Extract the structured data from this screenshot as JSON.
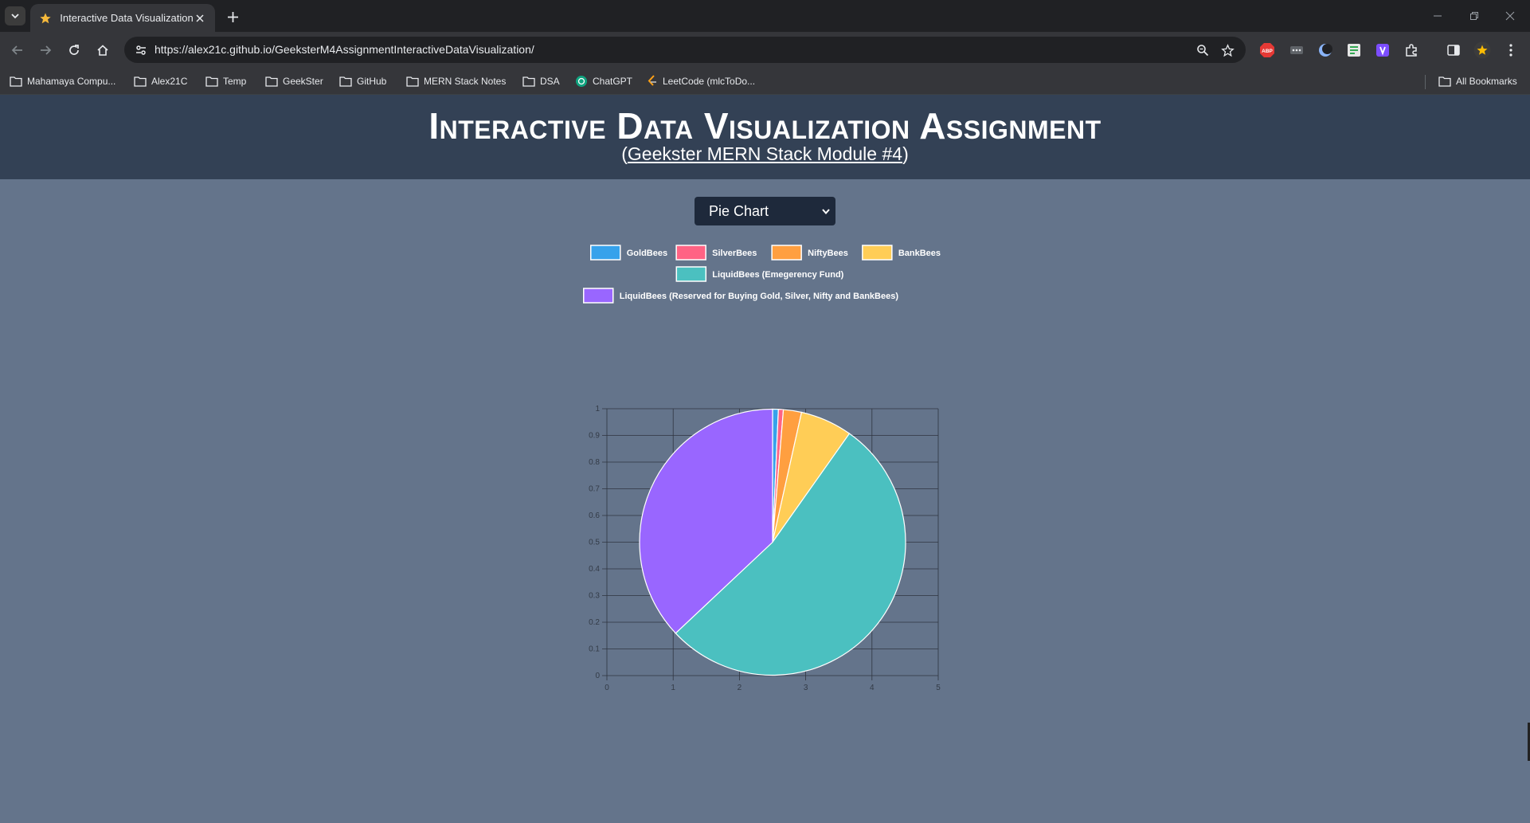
{
  "browser": {
    "tab_title": "Interactive Data Visualization",
    "url": "https://alex21c.github.io/GeeksterM4AssignmentInteractiveDataVisualization/",
    "bookmarks": [
      "Mahamaya Compu...",
      "Alex21C",
      "Temp",
      "GeekSter",
      "GitHub",
      "MERN Stack Notes",
      "DSA",
      "ChatGPT",
      "LeetCode (mlcToDo..."
    ],
    "all_bookmarks": "All Bookmarks"
  },
  "page": {
    "title": "Interactive Data Visualization Assignment",
    "subtitle_open": "(",
    "subtitle_link": "Geekster MERN Stack Module #4",
    "subtitle_close": ")",
    "background": "#64748b",
    "header_background": "#334155"
  },
  "chart_select": {
    "selected": "Pie Chart"
  },
  "chart_data": {
    "type": "pie",
    "labels": [
      "GoldBees",
      "SilverBees",
      "NiftyBees",
      "BankBees",
      "LiquidBees (Emegerency Fund)",
      "LiquidBees (Reserved for Buying Gold, Silver, Nifty and BankBees)"
    ],
    "values": [
      0.7,
      0.6,
      2.2,
      6.3,
      53.2,
      37.0
    ],
    "colors": [
      "#36a2eb",
      "#ff6384",
      "#ff9f40",
      "#ffcd56",
      "#4bc0c0",
      "#9966ff"
    ],
    "legend_position": "top",
    "x_ticks": [
      "0",
      "1",
      "2",
      "3",
      "4",
      "5"
    ],
    "y_ticks": [
      "0",
      "0.1",
      "0.2",
      "0.3",
      "0.4",
      "0.5",
      "0.6",
      "0.7",
      "0.8",
      "0.9",
      "1"
    ],
    "xlim": [
      0,
      5
    ],
    "ylim": [
      0,
      1
    ],
    "grid": true
  }
}
